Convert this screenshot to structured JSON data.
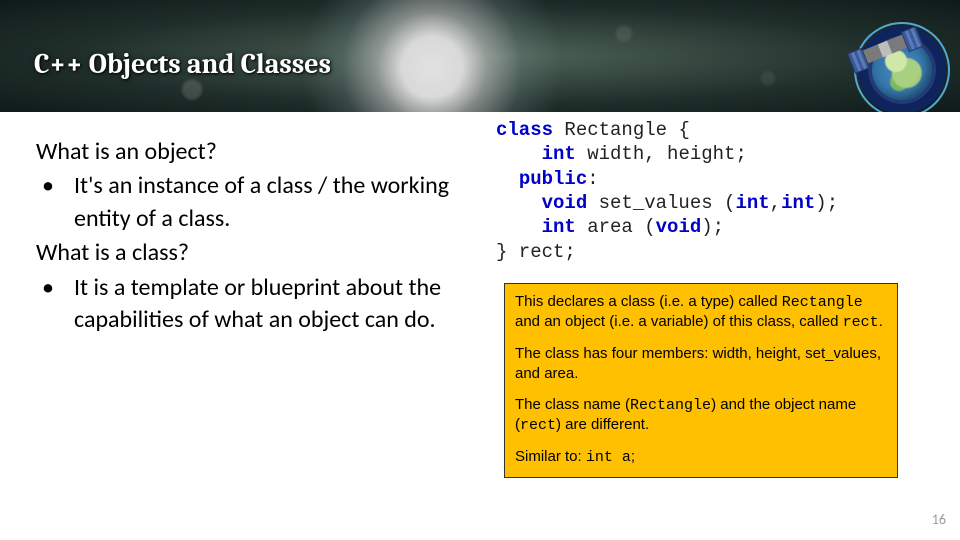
{
  "title": "C++ Objects and Classes",
  "logo": {
    "name": "jcsda-logo"
  },
  "left": {
    "q1": "What is an object?",
    "b1": "It's an instance of a class / the working entity of a class.",
    "q2": "What is a class?",
    "b2": "It is a template or blueprint about the capabilities of what an object can do."
  },
  "code": {
    "kw_class": "class",
    "name": "Rectangle",
    "open": " {",
    "kw_int1": "int",
    "members": " width, height;",
    "kw_public": "public",
    "colon": ":",
    "kw_void1": "void",
    "setvals": " set_values (",
    "kw_int2": "int",
    "comma": ",",
    "kw_int3": "int",
    "closeparen1": ");",
    "kw_int4": "int",
    "area": " area (",
    "kw_void2": "void",
    "closeparen2": ");",
    "close": "} rect;"
  },
  "callout": {
    "p1a": "This declares a class (i.e. a type) called ",
    "p1code1": "Rectangle",
    "p1b": " and an object (i.e. a variable) of this class, called ",
    "p1code2": "rect",
    "p1c": ".",
    "p2": "The class has four members: width, height, set_values, and area.",
    "p3a": "The class name (",
    "p3code1": "Rectangle",
    "p3b": ") and the object name (",
    "p3code2": "rect",
    "p3c": ") are different.",
    "p4a": "Similar to: ",
    "p4code": "int a",
    "p4b": ";"
  },
  "page_number": "16"
}
